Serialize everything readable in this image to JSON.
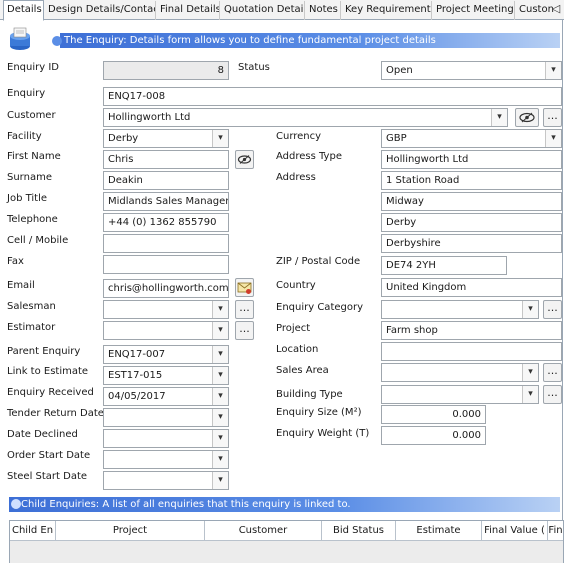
{
  "tabs": [
    {
      "label": "Details",
      "active": true
    },
    {
      "label": "Design Details/Contacts"
    },
    {
      "label": "Final Details"
    },
    {
      "label": "Quotation Details"
    },
    {
      "label": "Notes"
    },
    {
      "label": "Key Requirements"
    },
    {
      "label": "Project Meetings"
    },
    {
      "label": "Custon"
    }
  ],
  "banner_text": "The Enquiry: Details form allows you to define fundamental project details",
  "left": {
    "enquiry_id": {
      "label": "Enquiry ID",
      "value": "8"
    },
    "enquiry": {
      "label": "Enquiry",
      "value": "ENQ17-008"
    },
    "customer": {
      "label": "Customer",
      "value": "Hollingworth Ltd"
    },
    "facility": {
      "label": "Facility",
      "value": "Derby"
    },
    "first_name": {
      "label": "First Name",
      "value": "Chris"
    },
    "surname": {
      "label": "Surname",
      "value": "Deakin"
    },
    "job_title": {
      "label": "Job Title",
      "value": "Midlands Sales Manager"
    },
    "telephone": {
      "label": "Telephone",
      "value": "+44 (0) 1362 855790"
    },
    "cell": {
      "label": "Cell / Mobile",
      "value": ""
    },
    "fax": {
      "label": "Fax",
      "value": ""
    },
    "email": {
      "label": "Email",
      "value": "chris@hollingworth.com"
    },
    "salesman": {
      "label": "Salesman",
      "value": ""
    },
    "estimator": {
      "label": "Estimator",
      "value": ""
    },
    "parent_enquiry": {
      "label": "Parent Enquiry",
      "value": "ENQ17-007"
    },
    "link_estimate": {
      "label": "Link to Estimate",
      "value": "EST17-015"
    },
    "enquiry_received": {
      "label": "Enquiry Received",
      "value": "04/05/2017"
    },
    "tender_return": {
      "label": "Tender Return Date",
      "value": ""
    },
    "date_declined": {
      "label": "Date Declined",
      "value": ""
    },
    "order_start": {
      "label": "Order Start Date",
      "value": ""
    },
    "steel_start": {
      "label": "Steel Start Date",
      "value": ""
    }
  },
  "right": {
    "status": {
      "label": "Status",
      "value": "Open"
    },
    "currency": {
      "label": "Currency",
      "value": "GBP"
    },
    "address_type": {
      "label": "Address Type",
      "value": "Hollingworth Ltd"
    },
    "address": {
      "label": "Address",
      "lines": [
        "1 Station Road",
        "Midway",
        "Derby",
        "Derbyshire"
      ]
    },
    "zip": {
      "label": "ZIP / Postal Code",
      "value": "DE74 2YH"
    },
    "country": {
      "label": "Country",
      "value": "United Kingdom"
    },
    "enquiry_category": {
      "label": "Enquiry Category",
      "value": ""
    },
    "project": {
      "label": "Project",
      "value": "Farm shop"
    },
    "location": {
      "label": "Location",
      "value": ""
    },
    "sales_area": {
      "label": "Sales Area",
      "value": ""
    },
    "building_type": {
      "label": "Building Type",
      "value": ""
    },
    "enquiry_size": {
      "label": "Enquiry Size (M²)",
      "value": "0.000"
    },
    "enquiry_weight": {
      "label": "Enquiry Weight (T)",
      "value": "0.000"
    }
  },
  "child_banner_text": "Child Enquiries: A list of all enquiries that this enquiry is linked to.",
  "child_grid_columns": [
    "Child En",
    "Project",
    "Customer",
    "Bid Status",
    "Estimate",
    "Final Value (",
    "Fin"
  ],
  "buttons": {
    "ellipsis": "..."
  },
  "icons": {
    "tab_scroll": "◁",
    "dropdown": "▾"
  }
}
